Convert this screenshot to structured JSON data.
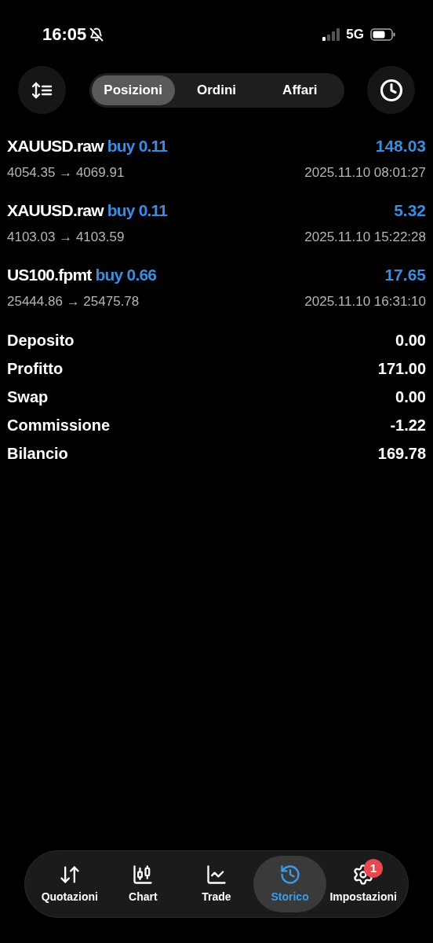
{
  "status_bar": {
    "time": "16:05",
    "network": "5G",
    "silent": true
  },
  "segments": [
    {
      "label": "Posizioni",
      "selected": true
    },
    {
      "label": "Ordini",
      "selected": false
    },
    {
      "label": "Affari",
      "selected": false
    }
  ],
  "trades": [
    {
      "symbol": "XAUUSD.raw",
      "side": "buy 0.11",
      "profit": "148.03",
      "prices": "4054.35 → 4069.91",
      "time": "2025.11.10 08:01:27"
    },
    {
      "symbol": "XAUUSD.raw",
      "side": "buy 0.11",
      "profit": "5.32",
      "prices": "4103.03 → 4103.59",
      "time": "2025.11.10 15:22:28"
    },
    {
      "symbol": "US100.fpmt",
      "side": "buy 0.66",
      "profit": "17.65",
      "prices": "25444.86 → 25475.78",
      "time": "2025.11.10 16:31:10"
    }
  ],
  "summary": [
    {
      "label": "Deposito",
      "value": "0.00"
    },
    {
      "label": "Profitto",
      "value": "171.00"
    },
    {
      "label": "Swap",
      "value": "0.00"
    },
    {
      "label": "Commissione",
      "value": "-1.22"
    },
    {
      "label": "Bilancio",
      "value": "169.78"
    }
  ],
  "tab_bar": [
    {
      "label": "Quotazioni",
      "selected": false
    },
    {
      "label": "Chart",
      "selected": false
    },
    {
      "label": "Trade",
      "selected": false
    },
    {
      "label": "Storico",
      "selected": true
    },
    {
      "label": "Impostazioni",
      "selected": false,
      "badge": "1"
    }
  ]
}
